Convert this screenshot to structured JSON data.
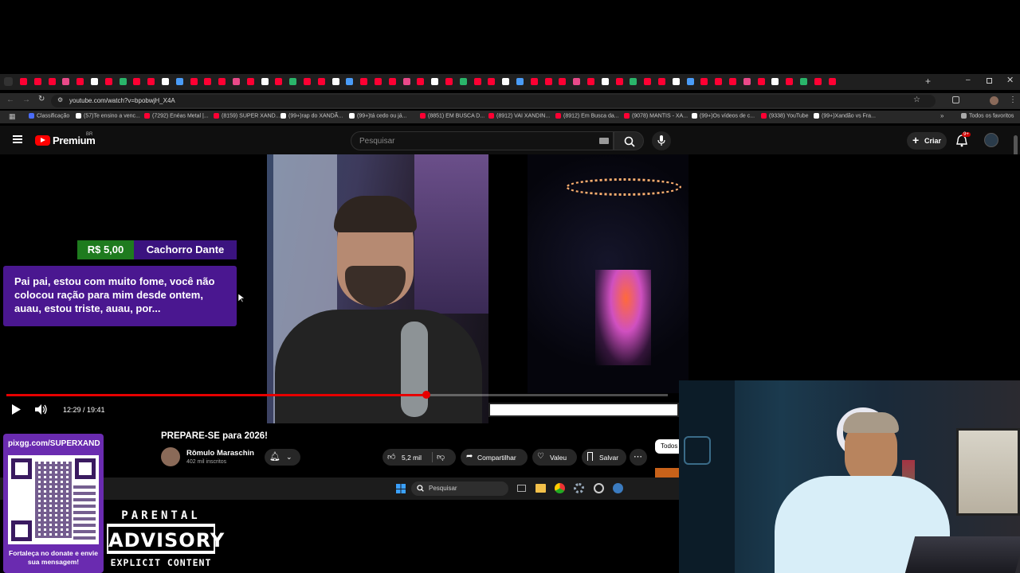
{
  "browser": {
    "url": "youtube.com/watch?v=bpobwjH_X4A",
    "bookmarks": [
      {
        "label": "Classificação",
        "color": "#4a6cf7"
      },
      {
        "label": "(57)Te ensino a venc...",
        "color": "#ffffff"
      },
      {
        "label": "(7292) Enéas Metal |...",
        "color": "#ff0033"
      },
      {
        "label": "(8159) SUPER XAND...",
        "color": "#ff0033"
      },
      {
        "label": "(99+)rap do XANDÃ...",
        "color": "#ffffff"
      },
      {
        "label": "(99+)tá cedo ou já...",
        "color": "#ffffff"
      },
      {
        "label": "(8851) EM BUSCA D...",
        "color": "#ff0033"
      },
      {
        "label": "(8912) VAI XANDIN...",
        "color": "#ff0033"
      },
      {
        "label": "(8912) Em Busca da...",
        "color": "#ff0033"
      },
      {
        "label": "(9078) MANTIS - XA...",
        "color": "#ff0033"
      },
      {
        "label": "(99+)Os vídeos de c...",
        "color": "#ffffff"
      },
      {
        "label": "(9338) YouTube",
        "color": "#ff0033"
      },
      {
        "label": "(99+)Xandão vs Fra...",
        "color": "#ffffff"
      }
    ],
    "all_favorites": "Todos os favoritos"
  },
  "youtube": {
    "logo": "Premium",
    "region": "BR",
    "search_placeholder": "Pesquisar",
    "create_label": "Criar",
    "notif_badge": "9+"
  },
  "player": {
    "time": "12:29 / 19:41",
    "progress": 0.635
  },
  "donation": {
    "amount": "R$ 5,00",
    "name": "Cachorro Dante",
    "message": "Pai pai, estou com muito fome, você não colocou ração para mim desde ontem, auau, estou triste, auau, por..."
  },
  "video_info": {
    "title": "PREPARE-SE para 2026!",
    "channel": "Rômulo Maraschin",
    "subscribers": "402 mil inscritos",
    "likes": "5,2 mil",
    "share": "Compartilhar",
    "thanks": "Valeu",
    "save": "Salvar",
    "chip": "Todos"
  },
  "taskbar": {
    "search_placeholder": "Pesquisar"
  },
  "overlay": {
    "pix_url": "pixgg.com/SUPERXAND",
    "pix_caption": "Fortaleça no donate e envie sua mensagem!",
    "advisory_line1": "PARENTAL",
    "advisory_line2": "ADVISORY",
    "advisory_line3": "EXPLICIT CONTENT"
  },
  "colors": {
    "accent_red": "#e60000",
    "donation_green": "#1e7b1e",
    "donation_purple": "#4a1790",
    "pix_purple": "#6a2bb0"
  }
}
